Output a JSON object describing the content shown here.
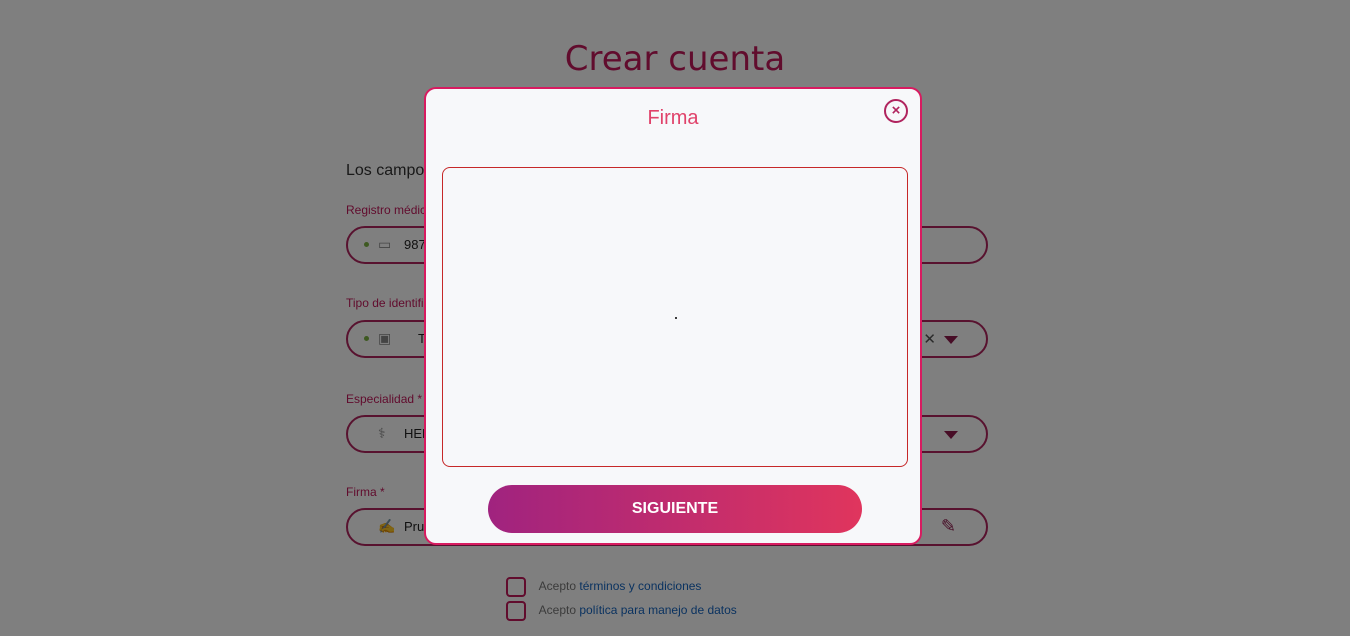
{
  "page": {
    "title": "Crear cuenta",
    "intro": "Los campo",
    "fields": [
      {
        "label": "Registro médic",
        "value": "987"
      },
      {
        "label": "Tipo de identifi",
        "value": "T"
      },
      {
        "label": "Especialidad *",
        "value": "HEN"
      },
      {
        "label": "Firma *",
        "value": "Pru"
      }
    ],
    "terms": {
      "prefix": "Acepto",
      "link": "términos y condiciones"
    },
    "privacy": {
      "prefix": "Acepto",
      "link": "política para manejo de datos"
    }
  },
  "modal": {
    "title": "Firma",
    "close_icon": "close-circle-icon",
    "next_label": "SIGUIENTE"
  },
  "colors": {
    "accent": "#c2185b",
    "gradient_start": "#a0237f",
    "gradient_end": "#e0355d"
  }
}
